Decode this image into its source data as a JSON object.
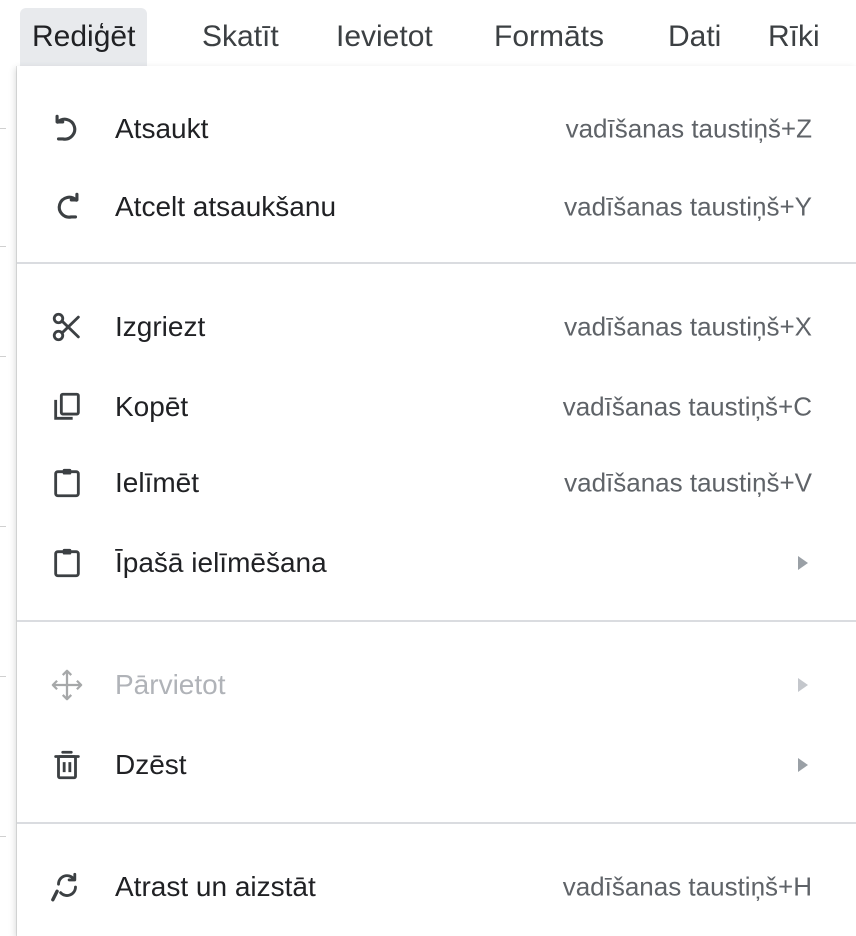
{
  "menubar": {
    "items": [
      {
        "label": "Rediģēt",
        "active": true
      },
      {
        "label": "Skatīt",
        "active": false
      },
      {
        "label": "Ievietot",
        "active": false
      },
      {
        "label": "Formāts",
        "active": false
      },
      {
        "label": "Dati",
        "active": false
      },
      {
        "label": "Rīki",
        "active": false
      }
    ]
  },
  "dropdown": {
    "items": [
      {
        "icon": "undo-icon",
        "label": "Atsaukt",
        "shortcut": "vadīšanas taustiņš+Z"
      },
      {
        "icon": "redo-icon",
        "label": "Atcelt atsaukšanu",
        "shortcut": "vadīšanas taustiņš+Y"
      },
      {
        "icon": "scissors-icon",
        "label": "Izgriezt",
        "shortcut": "vadīšanas taustiņš+X"
      },
      {
        "icon": "copy-icon",
        "label": "Kopēt",
        "shortcut": "vadīšanas taustiņš+C"
      },
      {
        "icon": "clipboard-icon",
        "label": "Ielīmēt",
        "shortcut": "vadīšanas taustiņš+V"
      },
      {
        "icon": "clipboard-icon",
        "label": "Īpašā ielīmēšana",
        "submenu": true
      },
      {
        "icon": "move-icon",
        "label": "Pārvietot",
        "submenu": true,
        "disabled": true
      },
      {
        "icon": "trash-icon",
        "label": "Dzēst",
        "submenu": true
      },
      {
        "icon": "find-replace-icon",
        "label": "Atrast un aizstāt",
        "shortcut": "vadīšanas taustiņš+H"
      }
    ]
  },
  "colors": {
    "text": "#202124",
    "shortcut": "#5f6368",
    "disabled": "#b0b3b8",
    "separator": "#dadce0",
    "active_tab": "#e8eaed"
  }
}
